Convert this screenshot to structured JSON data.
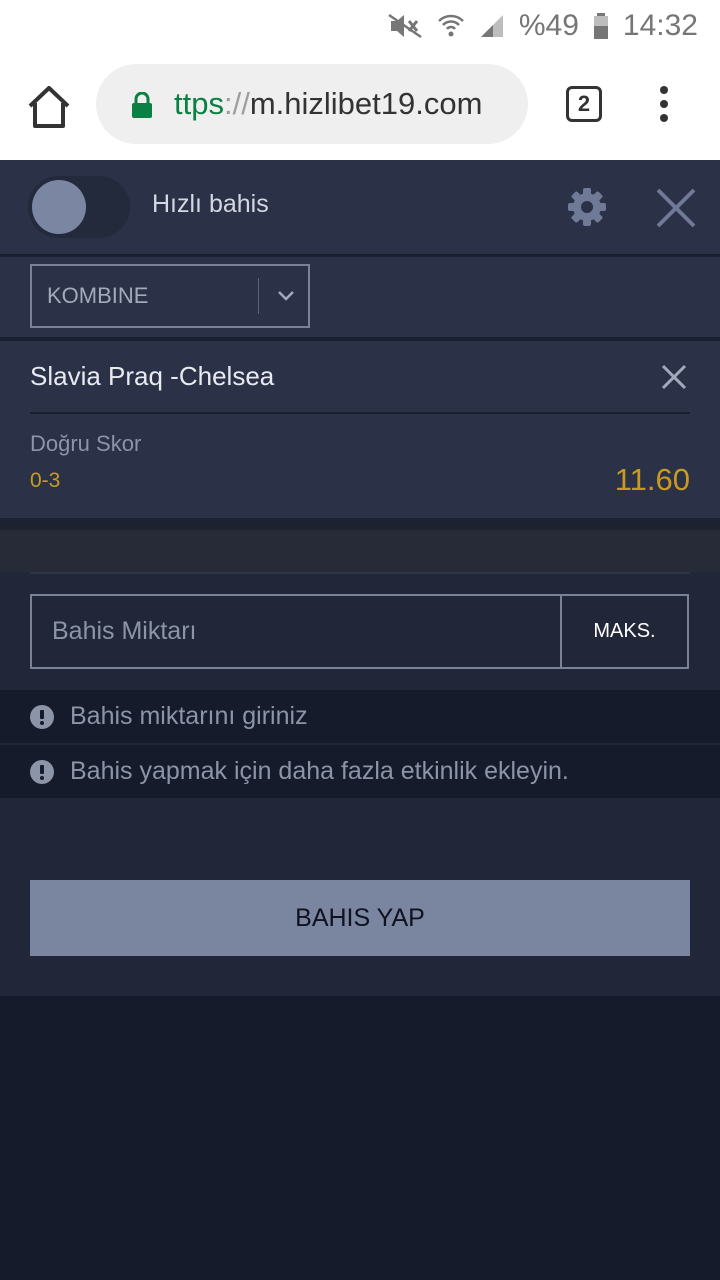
{
  "status_bar": {
    "battery": "%49",
    "time": "14:32"
  },
  "browser": {
    "url_scheme": "ttps",
    "url_sep": "://",
    "url_host": "m.hizlibet19.com",
    "tab_count": "2"
  },
  "bet_slip": {
    "quick_bet_label": "Hızlı bahis",
    "bet_type": "KOMBINE",
    "event": {
      "match": "Slavia Praq -Chelsea",
      "market": "Doğru Skor",
      "selection": "0-3",
      "odds": "11.60"
    },
    "stake": {
      "placeholder": "Bahis Miktarı",
      "max_label": "MAKS."
    },
    "messages": [
      "Bahis miktarını giriniz",
      "Bahis yapmak için daha fazla etkinlik ekleyin."
    ],
    "submit_label": "BAHIS YAP"
  },
  "colors": {
    "panel": "#2b3146",
    "background": "#161b2b",
    "odds": "#c99a22",
    "secure": "#0b8043",
    "submit_button": "#7a86a0"
  }
}
